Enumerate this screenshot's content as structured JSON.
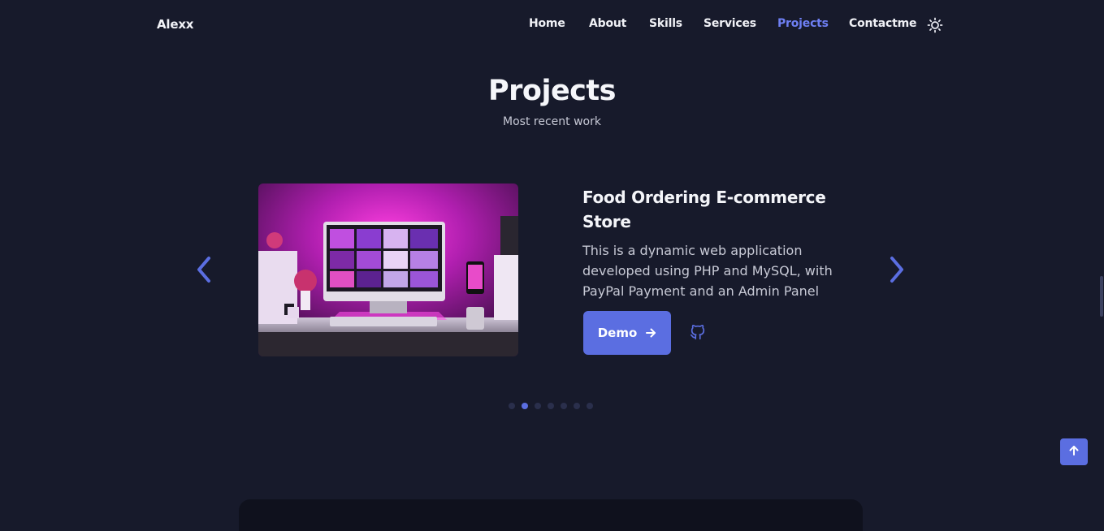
{
  "header": {
    "logo": "Alexx",
    "nav": [
      {
        "label": "Home",
        "active": false
      },
      {
        "label": "About",
        "active": false
      },
      {
        "label": "Skills",
        "active": false
      },
      {
        "label": "Services",
        "active": false
      },
      {
        "label": "Projects",
        "active": true
      },
      {
        "label": "Contactme",
        "active": false
      }
    ],
    "theme_icon": "sun-icon"
  },
  "section": {
    "title": "Projects",
    "subtitle": "Most recent work"
  },
  "project": {
    "title": "Food Ordering E-commerce Store",
    "description": "This is a dynamic web application developed using PHP and MySQL, with PayPal Payment and an Admin Panel",
    "demo_label": "Demo",
    "demo_icon": "arrow-right-icon",
    "github_icon": "github-icon"
  },
  "carousel": {
    "prev_icon": "chevron-left-icon",
    "next_icon": "chevron-right-icon",
    "slide_count": 7,
    "active_index": 1
  },
  "scroll_up_icon": "arrow-up-icon",
  "colors": {
    "background": "#171a2b",
    "accent": "#5b6ee1",
    "active_nav": "#6e7ff3"
  }
}
